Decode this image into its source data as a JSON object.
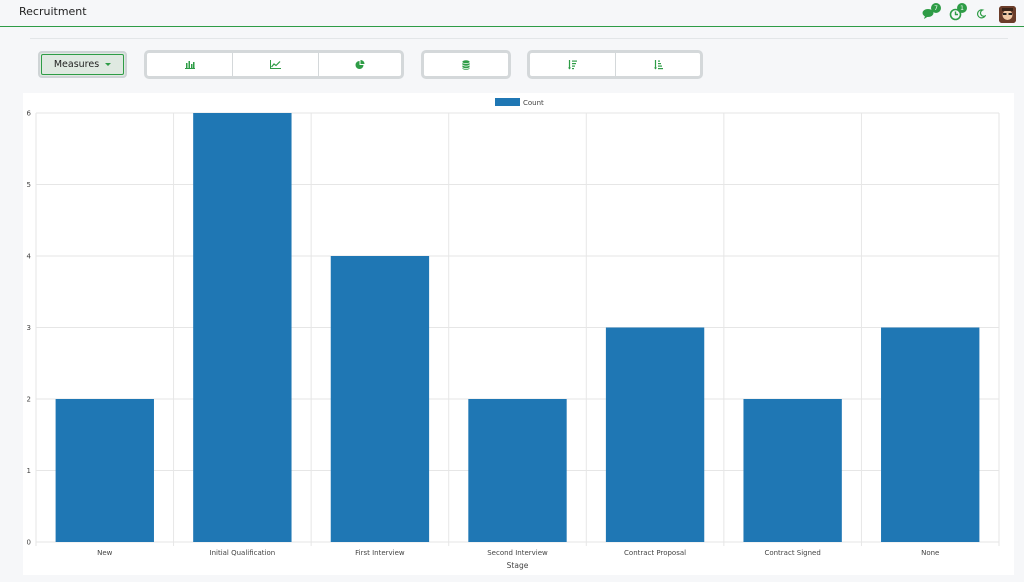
{
  "app": {
    "title": "Recruitment"
  },
  "topbar": {
    "messages_badge": "7",
    "activities_badge": "1"
  },
  "toolbar": {
    "measures_label": "Measures",
    "chart_type_buttons": [
      "bar-chart-icon",
      "line-chart-icon",
      "pie-chart-icon"
    ],
    "stack_button": "database-icon",
    "sort_buttons": [
      "sort-descending-icon",
      "sort-ascending-icon"
    ]
  },
  "colors": {
    "accent": "#2e9c46",
    "bar": "#1f77b4"
  },
  "chart_data": {
    "type": "bar",
    "categories": [
      "New",
      "Initial Qualification",
      "First Interview",
      "Second Interview",
      "Contract Proposal",
      "Contract Signed",
      "None"
    ],
    "series": [
      {
        "name": "Count",
        "values": [
          2,
          6,
          4,
          2,
          3,
          2,
          3
        ]
      }
    ],
    "xlabel": "Stage",
    "ylabel": "",
    "ylim": [
      0,
      6
    ],
    "yticks": [
      0,
      1,
      2,
      3,
      4,
      5,
      6
    ],
    "grid": true,
    "legend": "top-center"
  }
}
